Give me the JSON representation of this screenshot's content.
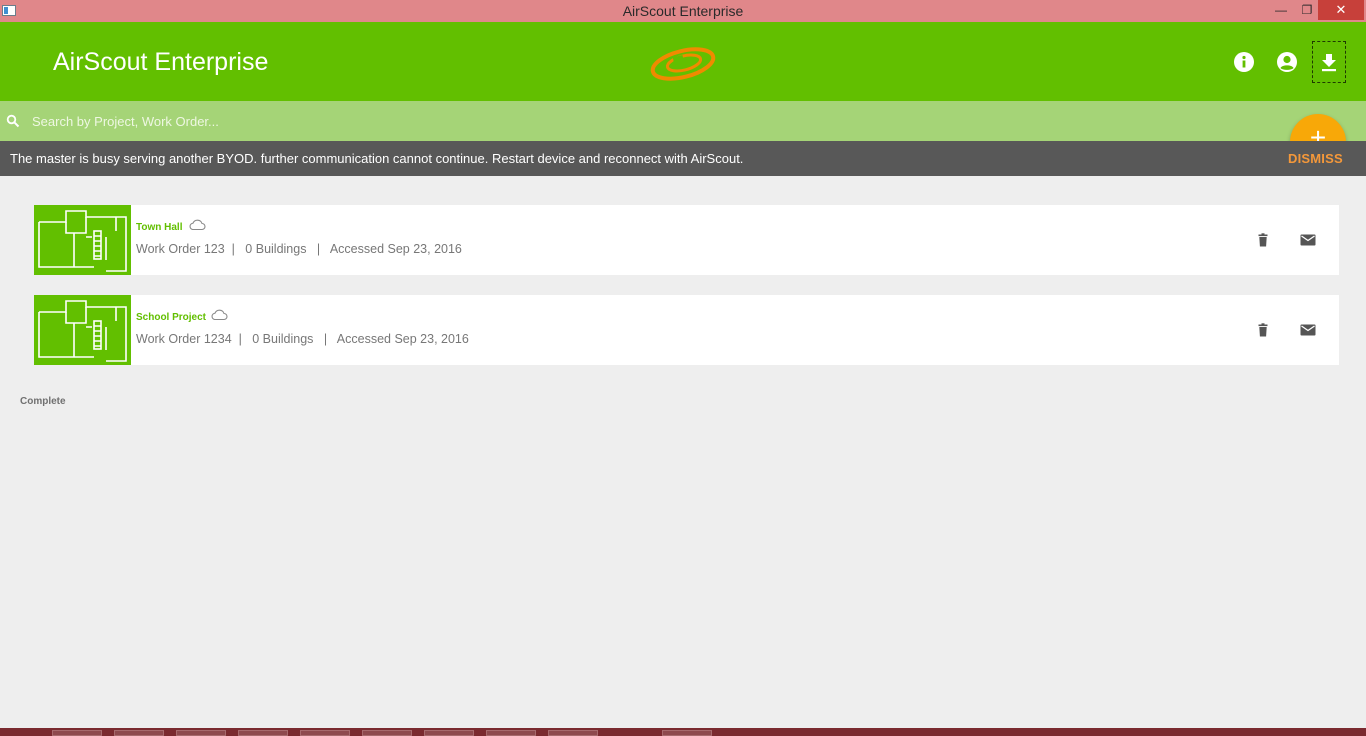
{
  "window": {
    "title": "AirScout Enterprise",
    "min_glyph": "—",
    "max_glyph": "❐",
    "close_glyph": "✕"
  },
  "header": {
    "app_title": "AirScout Enterprise",
    "brand_color": "#62bf00",
    "logo_color": "#f08a00"
  },
  "search": {
    "placeholder": "Search by Project, Work Order..."
  },
  "fab": {
    "label": "+"
  },
  "snackbar": {
    "message": "The master is busy serving another BYOD. further communication cannot continue. Restart device and reconnect with AirScout.",
    "action": "DISMISS"
  },
  "projects": [
    {
      "name": "Town Hall",
      "work_order": "Work Order 123",
      "buildings": "0 Buildings",
      "accessed": "Accessed Sep 23, 2016",
      "meta": "Work Order 123  |   0 Buildings   |   Accessed Sep 23, 2016"
    },
    {
      "name": "School Project",
      "work_order": "Work Order 1234",
      "buildings": "0 Buildings",
      "accessed": "Accessed Sep 23, 2016",
      "meta": "Work Order 1234  |   0 Buildings   |   Accessed Sep 23, 2016"
    }
  ],
  "status": "Complete",
  "icons": {
    "info": "info-icon",
    "account": "account-icon",
    "download": "download-icon",
    "search": "search-icon",
    "cloud": "cloud-icon",
    "delete": "delete-icon",
    "mail": "mail-icon"
  }
}
